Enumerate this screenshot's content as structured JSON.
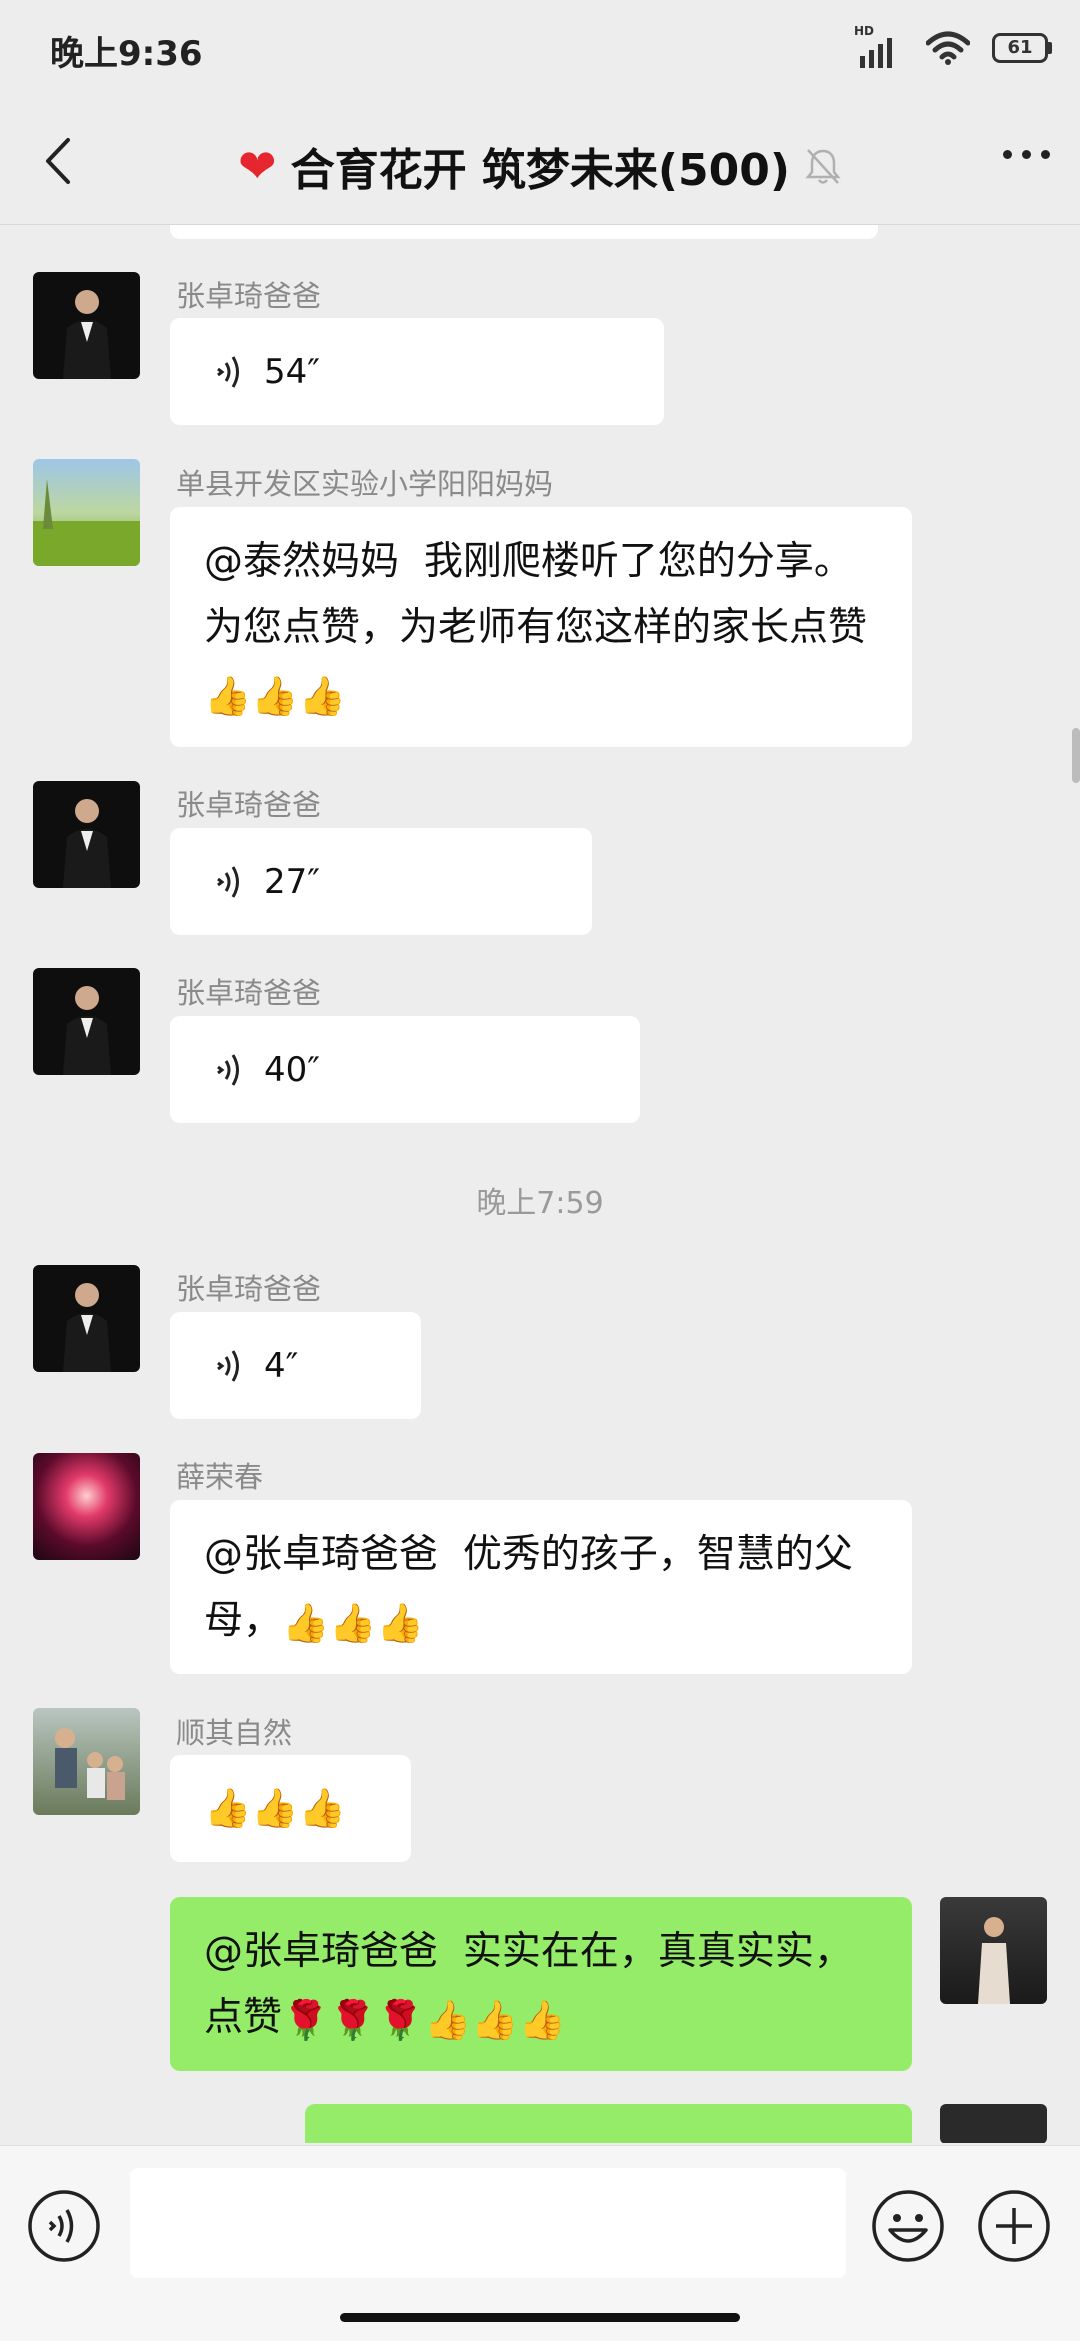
{
  "status": {
    "time": "晚上9:36",
    "hd": "HD",
    "battery": "61"
  },
  "header": {
    "title": "合育花开 筑梦未来(500)"
  },
  "time_divider": "晚上7:59",
  "messages": {
    "m1": {
      "sender": "张卓琦爸爸",
      "duration": "54″"
    },
    "m2": {
      "sender": "单县开发区实验小学阳阳妈妈",
      "mention": "@泰然妈妈",
      "text": "我刚爬楼听了您的分享。为您点赞，为老师有您这样的家长点赞",
      "emoji": "👍👍👍"
    },
    "m3": {
      "sender": "张卓琦爸爸",
      "duration": "27″"
    },
    "m4": {
      "sender": "张卓琦爸爸",
      "duration": "40″"
    },
    "m5": {
      "sender": "张卓琦爸爸",
      "duration": "4″"
    },
    "m6": {
      "sender": "薛荣春",
      "mention": "@张卓琦爸爸",
      "text": "优秀的孩子，智慧的父母，",
      "emoji": "👍👍👍"
    },
    "m7": {
      "sender": "顺其自然",
      "emoji": "👍👍👍"
    },
    "m8": {
      "mention": "@张卓琦爸爸",
      "text": "实实在在，真真实实，点赞",
      "roses": "🌹🌹🌹",
      "emoji": "👍👍👍"
    }
  },
  "colors": {
    "self_bubble": "#95ec69",
    "other_bubble": "#ffffff",
    "background": "#ededed"
  }
}
